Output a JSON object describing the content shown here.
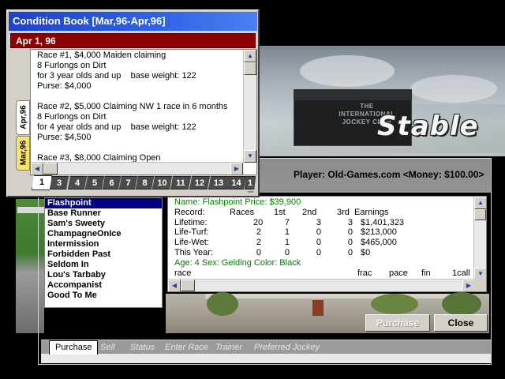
{
  "condition_book": {
    "title": "Condition Book [Mar,96-Apr,96]",
    "current_date": "Apr 1, 96",
    "months": [
      "Apr,96",
      "Mar,96"
    ],
    "races": [
      {
        "line1": "Race #1, $4,000 Maiden claiming",
        "line2": "8 Furlongs on Dirt",
        "line3": "for 3 year olds and up    base weight: 122",
        "line4": "Purse: $4,000"
      },
      {
        "line1": "Race #2, $5,000 Claiming NW 1 race in 6 months",
        "line2": "8 Furlongs on Dirt",
        "line3": "for 4 year olds and up    base weight: 122",
        "line4": "Purse: $4,500"
      },
      {
        "line1": "Race #3, $8,000 Claiming Open",
        "line2": "",
        "line3": "",
        "line4": ""
      }
    ],
    "day_tabs": [
      "1",
      "3",
      "4",
      "5",
      "6",
      "7",
      "8",
      "10",
      "11",
      "12",
      "13",
      "14",
      "1"
    ],
    "active_day": "1",
    "scroll_up_glyph": "▲",
    "scroll_down_glyph": "▼",
    "scroll_left_glyph": "◀",
    "scroll_right_glyph": "▶"
  },
  "scene": {
    "logo": "Stable",
    "board_text": "THE INTERNATIONAL JOCKEY CLUB"
  },
  "stable": {
    "player_info": "Player: Old-Games.com <Money: $100.00>",
    "horses": [
      "Flashpoint",
      "Base Runner",
      "Sam's Sweety",
      "ChampagneOnIce",
      "Intermission",
      "Forbidden Past",
      "Seldom In",
      "Lou's Tarbaby",
      "Accompanist",
      "Good To Me"
    ],
    "selected_horse": "Flashpoint",
    "detail": {
      "name_line": "Name: Flashpoint   Price: $39,900",
      "header": {
        "label": "Record:",
        "races": "Races",
        "first": "1st",
        "second": "2nd",
        "third": "3rd",
        "earnings": "Earnings"
      },
      "records": [
        {
          "label": "Lifetime:",
          "races": "20",
          "first": "7",
          "second": "3",
          "third": "3",
          "earnings": "$1,401,323"
        },
        {
          "label": "Life-Turf:",
          "races": "2",
          "first": "1",
          "second": "0",
          "third": "0",
          "earnings": "$213,000"
        },
        {
          "label": "Life-Wet:",
          "races": "2",
          "first": "1",
          "second": "0",
          "third": "0",
          "earnings": "$465,000"
        },
        {
          "label": "This Year:",
          "races": "0",
          "first": "0",
          "second": "0",
          "third": "0",
          "earnings": "$0"
        }
      ],
      "age_line": "Age: 4  Sex: Gelding  Color: Black",
      "race_header": {
        "race": "race",
        "frac": "frac",
        "pace": "pace",
        "fin": "fin",
        "call": "1call"
      }
    },
    "buttons": {
      "purchase": "Purchase",
      "close": "Close"
    },
    "tabs": [
      "Purchase",
      "Sell",
      "Status",
      "Enter Race",
      "Trainer",
      "Preferred Jockey"
    ],
    "active_tab": "Purchase"
  },
  "colors": {
    "titlebar": "#2f63e6",
    "date_bar": "#8b0000",
    "selection": "#000080",
    "month_tab_active": "#f6e36a",
    "age_line_text": "#008000"
  }
}
